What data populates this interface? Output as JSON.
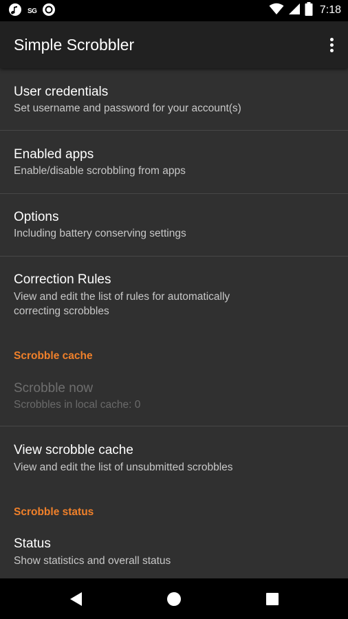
{
  "status_bar": {
    "time": "7:18",
    "left_icons": [
      "music-note-icon",
      "signal-sg-icon",
      "record-circle-icon"
    ],
    "left_text": "SG",
    "right_icons": [
      "wifi-icon",
      "cell-signal-icon",
      "battery-icon"
    ]
  },
  "app_bar": {
    "title": "Simple Scrobbler",
    "overflow_icon": "more-vert-icon"
  },
  "preferences": {
    "user_credentials": {
      "title": "User credentials",
      "summary": "Set username and password for your account(s)"
    },
    "enabled_apps": {
      "title": "Enabled apps",
      "summary": "Enable/disable scrobbling from apps"
    },
    "options": {
      "title": "Options",
      "summary": "Including battery conserving settings"
    },
    "correction_rules": {
      "title": "Correction Rules",
      "summary": "View and edit the list of rules for automatically correcting scrobbles"
    },
    "scrobble_cache_category": "Scrobble cache",
    "scrobble_now": {
      "title": "Scrobble now",
      "summary": "Scrobbles in local cache: 0"
    },
    "view_scrobble_cache": {
      "title": "View scrobble cache",
      "summary": "View and edit the list of unsubmitted scrobbles"
    },
    "scrobble_status_category": "Scrobble status",
    "status": {
      "title": "Status",
      "summary": "Show statistics and overall status"
    }
  },
  "nav_bar": {
    "icons": [
      "back-triangle-icon",
      "home-circle-icon",
      "recents-square-icon"
    ]
  },
  "colors": {
    "accent": "#f0802a",
    "background": "#303030",
    "app_bar": "#212121",
    "status_bar": "#000000"
  }
}
